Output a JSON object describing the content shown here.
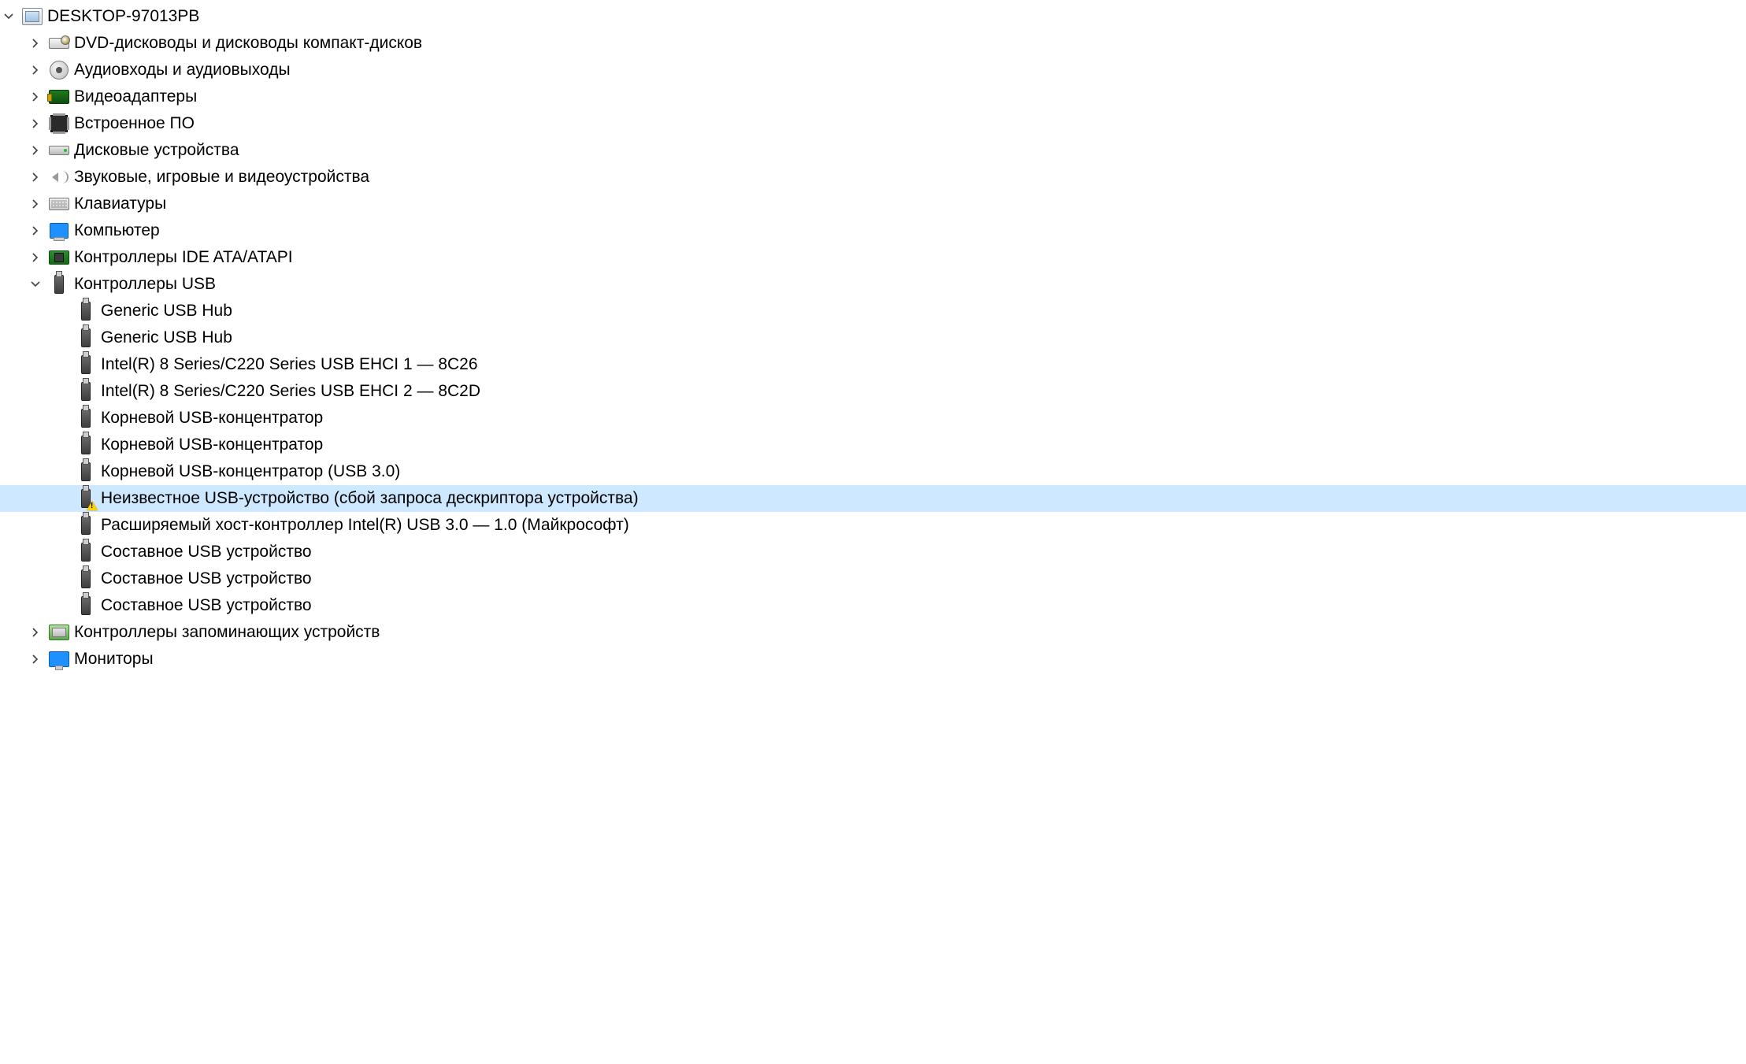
{
  "tree": {
    "root": {
      "label": "DESKTOP-97013PB",
      "expanded": true,
      "icon": "computer",
      "children": [
        {
          "label": "DVD-дисководы и дисководы компакт-дисков",
          "expanded": false,
          "icon": "dvd"
        },
        {
          "label": "Аудиовходы и аудиовыходы",
          "expanded": false,
          "icon": "audio"
        },
        {
          "label": "Видеоадаптеры",
          "expanded": false,
          "icon": "video"
        },
        {
          "label": "Встроенное ПО",
          "expanded": false,
          "icon": "firmware"
        },
        {
          "label": "Дисковые устройства",
          "expanded": false,
          "icon": "disk"
        },
        {
          "label": "Звуковые, игровые и видеоустройства",
          "expanded": false,
          "icon": "sound"
        },
        {
          "label": "Клавиатуры",
          "expanded": false,
          "icon": "keyboard"
        },
        {
          "label": "Компьютер",
          "expanded": false,
          "icon": "pc"
        },
        {
          "label": "Контроллеры IDE ATA/ATAPI",
          "expanded": false,
          "icon": "ide"
        },
        {
          "label": "Контроллеры USB",
          "expanded": true,
          "icon": "usb",
          "children": [
            {
              "label": "Generic USB Hub",
              "icon": "usb"
            },
            {
              "label": "Generic USB Hub",
              "icon": "usb"
            },
            {
              "label": "Intel(R) 8 Series/C220 Series USB EHCI 1 — 8C26",
              "icon": "usb"
            },
            {
              "label": "Intel(R) 8 Series/C220 Series USB EHCI 2 — 8C2D",
              "icon": "usb"
            },
            {
              "label": "Корневой USB-концентратор",
              "icon": "usb"
            },
            {
              "label": "Корневой USB-концентратор",
              "icon": "usb"
            },
            {
              "label": "Корневой USB-концентратор (USB 3.0)",
              "icon": "usb"
            },
            {
              "label": "Неизвестное USB-устройство (сбой запроса дескриптора устройства)",
              "icon": "usb",
              "warning": true,
              "selected": true
            },
            {
              "label": "Расширяемый хост-контроллер Intel(R) USB 3.0 — 1.0 (Майкрософт)",
              "icon": "usb"
            },
            {
              "label": "Составное USB устройство",
              "icon": "usb"
            },
            {
              "label": "Составное USB устройство",
              "icon": "usb"
            },
            {
              "label": "Составное USB устройство",
              "icon": "usb"
            }
          ]
        },
        {
          "label": "Контроллеры запоминающих устройств",
          "expanded": false,
          "icon": "storage"
        },
        {
          "label": "Мониторы",
          "expanded": false,
          "icon": "monitor"
        }
      ]
    }
  },
  "colors": {
    "selection": "#cde8ff"
  }
}
